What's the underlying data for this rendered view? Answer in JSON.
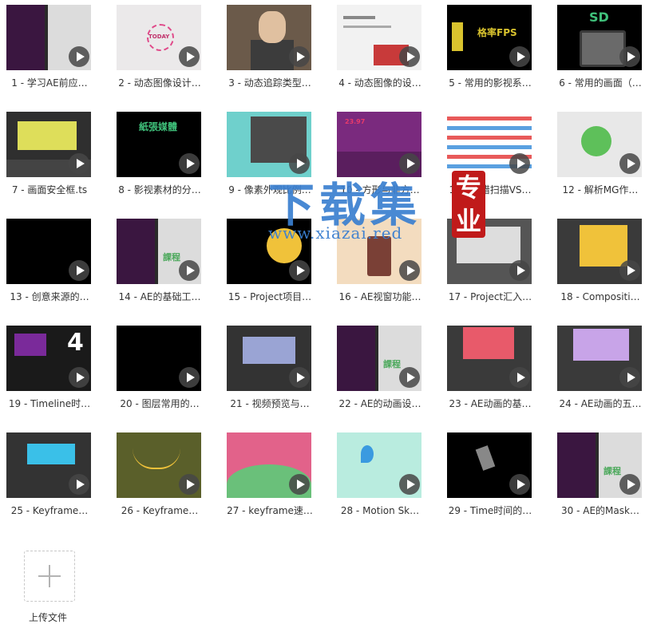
{
  "files": [
    {
      "caption": "1 - 学习AE前应…",
      "thumb": {
        "bg": "#2a2a2a"
      }
    },
    {
      "caption": "2 - 动态图像设计…",
      "thumb": {
        "bg": "#ebe9ea",
        "text": "TODAY"
      }
    },
    {
      "caption": "3 - 动态追踪类型…",
      "thumb": {
        "bg": "#6b5a4a"
      }
    },
    {
      "caption": "4 - 动态图像的设…",
      "thumb": {
        "bg": "#f2f2f2"
      }
    },
    {
      "caption": "5 - 常用的影视系…",
      "thumb": {
        "bg": "#000000",
        "text": "格率FPS"
      }
    },
    {
      "caption": "6 - 常用的画面（…",
      "thumb": {
        "bg": "#000000",
        "text": "SD"
      }
    },
    {
      "caption": "7 - 画面安全框.ts",
      "thumb": {
        "bg": "#2f2f2f"
      }
    },
    {
      "caption": "8 - 影视素材的分…",
      "thumb": {
        "bg": "#000000",
        "text": "紙張媒體"
      }
    },
    {
      "caption": "9 - 像素外观比例…",
      "thumb": {
        "bg": "#6fd0cc"
      }
    },
    {
      "caption": "10 - 方形与非方…",
      "thumb": {
        "bg": "#7a2a7e",
        "text": "23.97"
      }
    },
    {
      "caption": "11 - 交错扫描VS…",
      "thumb": {
        "bg": "#ffffff"
      }
    },
    {
      "caption": "12 - 解析MG作…",
      "thumb": {
        "bg": "#e8e8e8"
      }
    },
    {
      "caption": "13 - 创意来源的…",
      "thumb": {
        "bg": "#000000"
      }
    },
    {
      "caption": "14 - AE的基础工…",
      "thumb": {
        "bg": "#2a2a2a",
        "text": "課程"
      }
    },
    {
      "caption": "15 - Project项目…",
      "thumb": {
        "bg": "#000000"
      }
    },
    {
      "caption": "16 - AE视窗功能…",
      "thumb": {
        "bg": "#f3dcbf"
      }
    },
    {
      "caption": "17 - Project汇入…",
      "thumb": {
        "bg": "#555555"
      }
    },
    {
      "caption": "18 - Compositi…",
      "thumb": {
        "bg": "#3a3a3a"
      }
    },
    {
      "caption": "19 - Timeline时…",
      "thumb": {
        "bg": "#1a1a1a",
        "text": "4"
      }
    },
    {
      "caption": "20 - 图层常用的…",
      "thumb": {
        "bg": "#000000"
      }
    },
    {
      "caption": "21 - 视频预览与…",
      "thumb": {
        "bg": "#333333"
      }
    },
    {
      "caption": "22 - AE的动画设…",
      "thumb": {
        "bg": "#2a2a2a",
        "text": "課程"
      }
    },
    {
      "caption": "23 - AE动画的基…",
      "thumb": {
        "bg": "#3a3a3a"
      }
    },
    {
      "caption": "24 - AE动画的五…",
      "thumb": {
        "bg": "#3a3a3a"
      }
    },
    {
      "caption": "25 - Keyframe…",
      "thumb": {
        "bg": "#333333"
      }
    },
    {
      "caption": "26 - Keyframe…",
      "thumb": {
        "bg": "#5a5f2a"
      }
    },
    {
      "caption": "27 - keyframe速…",
      "thumb": {
        "bg": "#e2628a"
      }
    },
    {
      "caption": "28 - Motion Sk…",
      "thumb": {
        "bg": "#b9ecdf"
      }
    },
    {
      "caption": "29 - Time时间的…",
      "thumb": {
        "bg": "#000000"
      }
    },
    {
      "caption": "30 - AE的Mask…",
      "thumb": {
        "bg": "#2a2a2a",
        "text": "課程"
      }
    }
  ],
  "watermark": {
    "title": "下载集",
    "url": "www.xiazai.red",
    "seal": "专业"
  },
  "upload": {
    "label": "上传文件",
    "icon": "plus-icon"
  },
  "icons": {
    "play": "play-icon"
  }
}
